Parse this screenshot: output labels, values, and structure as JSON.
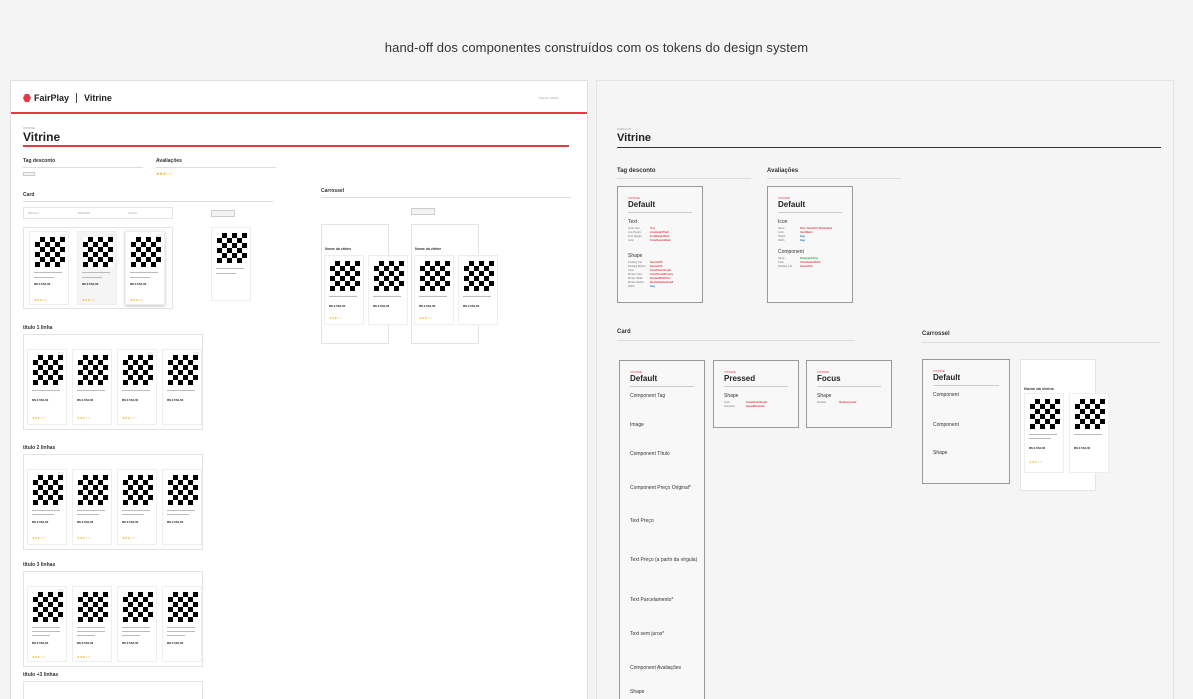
{
  "heading": "hand-off dos componentes construídos com os tokens do design system",
  "left": {
    "brand": "FairPlay",
    "product": "Vitrine",
    "breadcrumb": "Tokens / Vitrine",
    "eyebrow": "VITRINE",
    "title": "Vitrine",
    "tag_desconto": "Tag desconto",
    "avaliacoes": "Avaliações",
    "card": "Card",
    "carrossel": "Carrossel",
    "default_label": "DEFAULT",
    "pressed_label": "PRESSED",
    "focus_label": "FOCUS",
    "placeholder": "PLACEHOLDER",
    "nome_vitrine": "Nome da vitrine",
    "titulo1": "título 1 linha",
    "titulo2": "título 2 linhas",
    "titulo3": "título 3 linhas",
    "titulo4": "título +3 linhas",
    "sample_price": "R$ 2.564,00",
    "sample_stars": "★★★☆☆",
    "sample_count": "(120)"
  },
  "right": {
    "eyebrow": "HAND-ON",
    "title": "Vitrine",
    "tag_desconto": "Tag desconto",
    "avaliacoes": "Avaliações",
    "card": "Card",
    "carrossel": "Carrossel",
    "default_title": "Default",
    "pressed_title": "Pressed",
    "focus_title": "Focus",
    "eyebrow_small": "VITRINE",
    "tag_spec": {
      "text_group": "Text",
      "shape_group": "Shape",
      "text_props": [
        "Fonte Size",
        "Line Height",
        "Font Weight",
        "Color"
      ],
      "text_tokens": [
        "Tiny",
        "LineHeightTight",
        "FontWeightBold",
        "ColorNeutralDark"
      ],
      "shape_props": [
        "Padding Top",
        "Padding Bottom",
        "Color",
        "Border Color",
        "Border Width",
        "Border Radius",
        "Width"
      ],
      "shape_tokens": [
        "SpaceXXS",
        "SpaceXXS",
        "ColorNeutralLight",
        "ColorBrandPrimary",
        "BorderWidthThin",
        "BorderRadiusSmall",
        "Hug"
      ]
    },
    "aval_spec": {
      "icon_group": "Icon",
      "comp_group": "Component",
      "icon_props": [
        "Name",
        "Color",
        "Height",
        "Width"
      ],
      "icon_tokens": [
        "Star / StarHalf / StarOutline",
        "AlertWarm",
        "Hug",
        "Hug"
      ],
      "comp_props": [
        "Name",
        "Color",
        "Padding Left"
      ],
      "comp_tokens": [
        "Paragraph Tiny",
        "ColorNeutralDark",
        "SpaceXXS"
      ]
    },
    "card_default": {
      "groups": [
        "Component Tag",
        "Image",
        "Component Título",
        "Component Preço Original*",
        "Text Preço",
        "Text Preço (a partir da vírgula)",
        "Text Parcelamento*",
        "Text sem juros*",
        "Component Avaliações",
        "Shape"
      ]
    },
    "card_pressed": {
      "group": "Shape",
      "props": [
        "Color",
        "Transition"
      ],
      "tokens": [
        "ColorNeutralLight",
        "SpeedModerate"
      ]
    },
    "card_focus": {
      "group": "Shape",
      "props": [
        "Shadow"
      ],
      "tokens": [
        "ShadowLevel2"
      ]
    },
    "carousel_default": {
      "groups": [
        "Component",
        "Component",
        "Shape"
      ]
    }
  }
}
